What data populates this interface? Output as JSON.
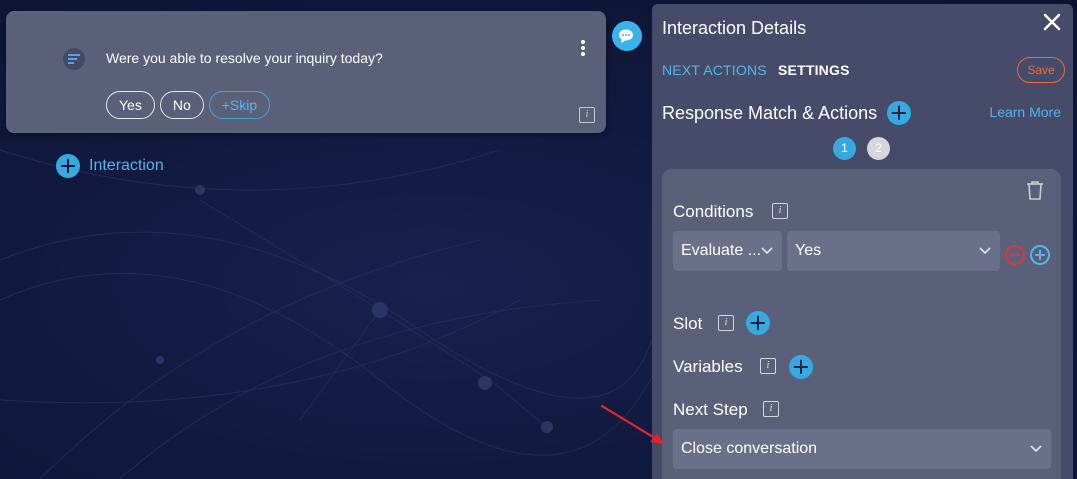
{
  "question_card": {
    "text": "Were you able to resolve your inquiry today?",
    "buttons": [
      "Yes",
      "No",
      "+Skip"
    ],
    "menu_icon": "kebab-menu-icon",
    "info_icon": "info-icon"
  },
  "canvas": {
    "add_interaction_label": "Interaction",
    "chat_icon": "chat-bubble-icon"
  },
  "panel": {
    "title": "Interaction Details",
    "close_icon": "close-icon",
    "tabs": [
      "NEXT ACTIONS",
      "SETTINGS"
    ],
    "active_tab": "NEXT ACTIONS",
    "save_label": "Save",
    "section_title": "Response Match & Actions",
    "learn_more": "Learn More",
    "steps": [
      "1",
      "2"
    ],
    "active_step": "1",
    "conditions": {
      "label": "Conditions",
      "evaluate_value": "Evaluate ...",
      "match_value": "Yes"
    },
    "slot_label": "Slot",
    "variables_label": "Variables",
    "next_step": {
      "label": "Next Step",
      "value": "Close conversation"
    }
  },
  "colors": {
    "accent": "#36a9e1",
    "panel_bg": "#454b68",
    "card_bg": "#5b6079",
    "save_border": "#f0693c",
    "remove_red": "#d9373b"
  }
}
